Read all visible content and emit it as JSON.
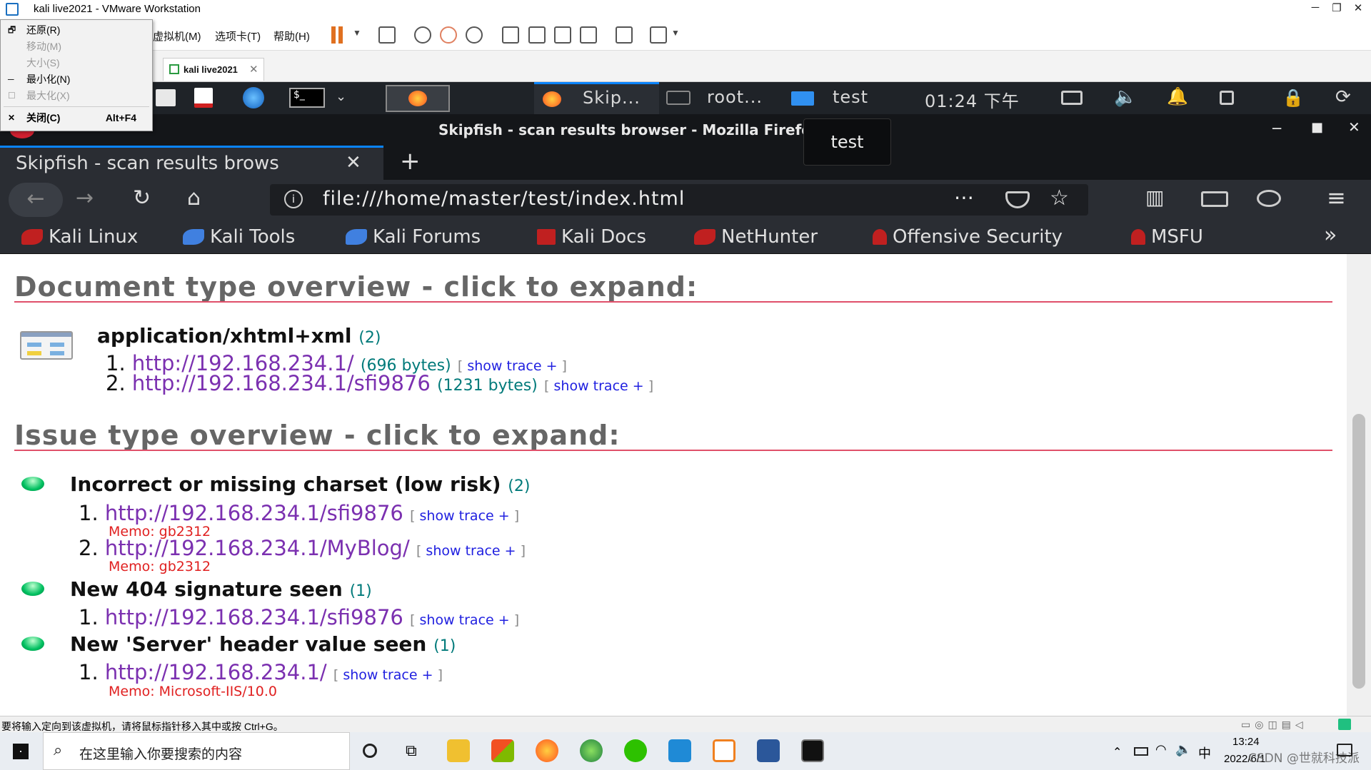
{
  "vmware": {
    "window_title": "kali live2021 - VMware Workstation",
    "menu": [
      "虚拟机(M)",
      "选项卡(T)",
      "帮助(H)"
    ],
    "tab_label": "kali live2021",
    "status_text": "要将输入定向到该虚拟机，请将鼠标指针移入其中或按 Ctrl+G。"
  },
  "system_menu": {
    "items": [
      {
        "label": "还原(R)",
        "icon": "restore-icon",
        "disabled": false,
        "shortcut": ""
      },
      {
        "label": "移动(M)",
        "icon": "",
        "disabled": true,
        "shortcut": ""
      },
      {
        "label": "大小(S)",
        "icon": "",
        "disabled": true,
        "shortcut": ""
      },
      {
        "label": "最小化(N)",
        "icon": "minimize-icon",
        "disabled": false,
        "shortcut": ""
      },
      {
        "label": "最大化(X)",
        "icon": "maximize-icon",
        "disabled": true,
        "shortcut": ""
      },
      {
        "label": "关闭(C)",
        "icon": "close-icon",
        "disabled": false,
        "shortcut": "Alt+F4"
      }
    ]
  },
  "kali_panel": {
    "windows": [
      "Skip...",
      "root...",
      "test"
    ],
    "clock": "01:24 下午",
    "tooltip": "test"
  },
  "firefox": {
    "window_title": "Skipfish - scan results browser - Mozilla Firefox",
    "tab_title": "Skipfish - scan results brows",
    "url": "file:///home/master/test/index.html",
    "bookmarks": [
      "Kali Linux",
      "Kali Tools",
      "Kali Forums",
      "Kali Docs",
      "NetHunter",
      "Offensive Security",
      "MSFU"
    ]
  },
  "page": {
    "doc_heading": "Document type overview - click to expand:",
    "doc_types": [
      {
        "type": "application/xhtml+xml",
        "count": "(2)",
        "items": [
          {
            "num": "1.",
            "url": "http://192.168.234.1/",
            "bytes": "(696 bytes)"
          },
          {
            "num": "2.",
            "url": "http://192.168.234.1/sfi9876",
            "bytes": "(1231 bytes)"
          }
        ]
      }
    ],
    "issue_heading": "Issue type overview - click to expand:",
    "trace_open": "[",
    "trace_label": "show trace +",
    "trace_close": "]",
    "issues": [
      {
        "title": "Incorrect or missing charset (low risk)",
        "count": "(2)",
        "items": [
          {
            "num": "1.",
            "url": "http://192.168.234.1/sfi9876",
            "memo": "Memo: gb2312"
          },
          {
            "num": "2.",
            "url": "http://192.168.234.1/MyBlog/",
            "memo": "Memo: gb2312"
          }
        ]
      },
      {
        "title": "New 404 signature seen",
        "count": "(1)",
        "items": [
          {
            "num": "1.",
            "url": "http://192.168.234.1/sfi9876",
            "memo": ""
          }
        ]
      },
      {
        "title": "New 'Server' header value seen",
        "count": "(1)",
        "items": [
          {
            "num": "1.",
            "url": "http://192.168.234.1/",
            "memo": "Memo: Microsoft-IIS/10.0"
          }
        ]
      }
    ]
  },
  "windows": {
    "search_placeholder": "在这里输入你要搜索的内容",
    "time": "13:24",
    "date": "2022/6/1",
    "ime": "中",
    "watermark": "CSDN @世就科技派"
  },
  "colors": {
    "link": "#7b30b0",
    "heading_rule": "#e0506a",
    "memo": "#e02020",
    "count": "#007a7a",
    "ff_accent": "#0a84ff"
  }
}
